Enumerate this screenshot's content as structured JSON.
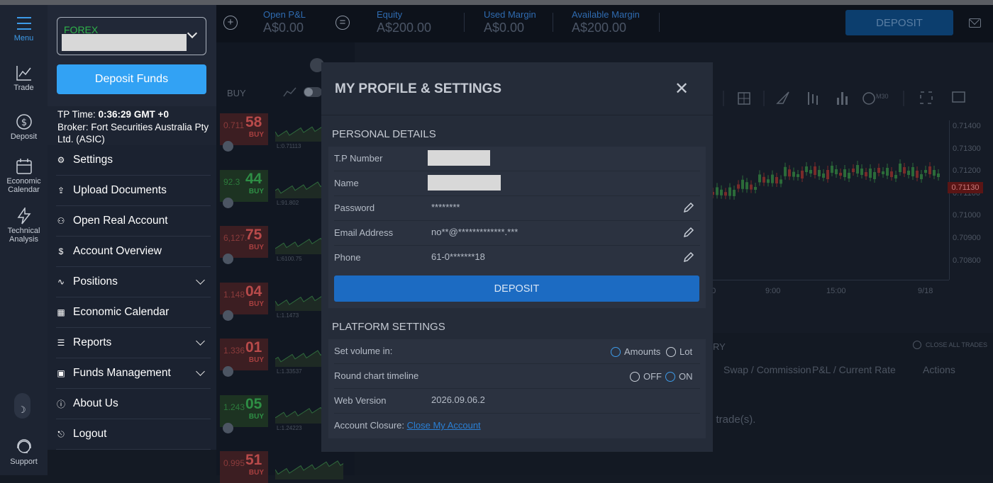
{
  "rail": {
    "items": [
      {
        "label": "Menu",
        "icon": "hamburger-icon"
      },
      {
        "label": "Trade",
        "icon": "chart-line-icon"
      },
      {
        "label": "Deposit",
        "icon": "dollar-circle-icon"
      },
      {
        "label": "Economic Calendar",
        "icon": "calendar-icon"
      },
      {
        "label": "Technical Analysis",
        "icon": "lightning-icon"
      },
      {
        "label": "Support",
        "icon": "headset-icon"
      }
    ]
  },
  "menu": {
    "account_type": "FOREX",
    "deposit_button": "Deposit Funds",
    "tp_time_label": "TP Time:",
    "tp_time_value": "0:36:29 GMT +0",
    "broker": "Broker: Fort Securities Australia Pty Ltd. (ASIC)",
    "items": [
      {
        "label": "Settings",
        "icon": "gear-icon"
      },
      {
        "label": "Upload Documents",
        "icon": "upload-icon"
      },
      {
        "label": "Open Real Account",
        "icon": "user-add-icon"
      },
      {
        "label": "Account Overview",
        "icon": "dollar-icon"
      },
      {
        "label": "Positions",
        "icon": "pulse-icon"
      },
      {
        "label": "Economic Calendar",
        "icon": "calendar-icon"
      },
      {
        "label": "Reports",
        "icon": "report-icon"
      },
      {
        "label": "Funds Management",
        "icon": "funds-icon"
      },
      {
        "label": "About Us",
        "icon": "info-icon"
      },
      {
        "label": "Logout",
        "icon": "logout-icon"
      }
    ]
  },
  "topbar": {
    "open_pl_label": "Open P&L",
    "open_pl_value": "A$0.00",
    "equity_label": "Equity",
    "equity_value": "A$200.00",
    "used_margin_label": "Used Margin",
    "used_margin_value": "A$0.00",
    "available_margin_label": "Available Margin",
    "available_margin_value": "A$200.00",
    "deposit_label": "DEPOSIT"
  },
  "background": {
    "buy_header": "BUY",
    "quotes": [
      {
        "small": "0.711",
        "big": "58",
        "side": "BUY",
        "low": "L:0.71113",
        "color": "red"
      },
      {
        "small": "92.3",
        "big": "44",
        "side": "BUY",
        "low": "L:91.802",
        "color": "green"
      },
      {
        "small": "6,127.",
        "big": "75",
        "side": "BUY",
        "low": "L:6100.75",
        "color": "red"
      },
      {
        "small": "1.148",
        "big": "04",
        "side": "BUY",
        "low": "L:1.1473",
        "color": "red"
      },
      {
        "small": "1.336",
        "big": "01",
        "side": "BUY",
        "low": "L:1.33537",
        "color": "red"
      },
      {
        "small": "1.243",
        "big": "05",
        "side": "BUY",
        "low": "L:1.24223",
        "color": "green"
      },
      {
        "small": "0.995",
        "big": "51",
        "side": "BUY",
        "low": "",
        "color": "red"
      }
    ],
    "chart_timeframe": "M30",
    "y_ticks": [
      "0.71400",
      "0.71300",
      "0.71200",
      "0.71100",
      "0.71000",
      "0.70900",
      "0.70800"
    ],
    "current_price": "0.71130",
    "x_ticks": [
      "00",
      "9:00",
      "15:00",
      "9/18"
    ],
    "table_section": "RY",
    "close_all": "CLOSE ALL TRADES",
    "table_headers": [
      "Swap / Commission",
      "P&L / Current Rate",
      "Actions"
    ],
    "empty_text": "n trade(s)."
  },
  "modal": {
    "title": "MY PROFILE & SETTINGS",
    "personal_title": "PERSONAL DETAILS",
    "fields": [
      {
        "label": "T.P Number",
        "value": ""
      },
      {
        "label": "Name",
        "value": ""
      },
      {
        "label": "Password",
        "value": "********"
      },
      {
        "label": "Email Address",
        "value": "no**@*************.***"
      },
      {
        "label": "Phone",
        "value": "61-0*******18"
      }
    ],
    "deposit_label": "DEPOSIT",
    "platform_title": "PLATFORM SETTINGS",
    "volume_label": "Set volume in:",
    "volume_options": [
      "Amounts",
      "Lot"
    ],
    "timeline_label": "Round chart timeline",
    "timeline_options": [
      "OFF",
      "ON"
    ],
    "web_version_label": "Web Version",
    "web_version_value": "2026.09.06.2",
    "closure_label": "Account Closure:",
    "closure_link": "Close My Account"
  }
}
